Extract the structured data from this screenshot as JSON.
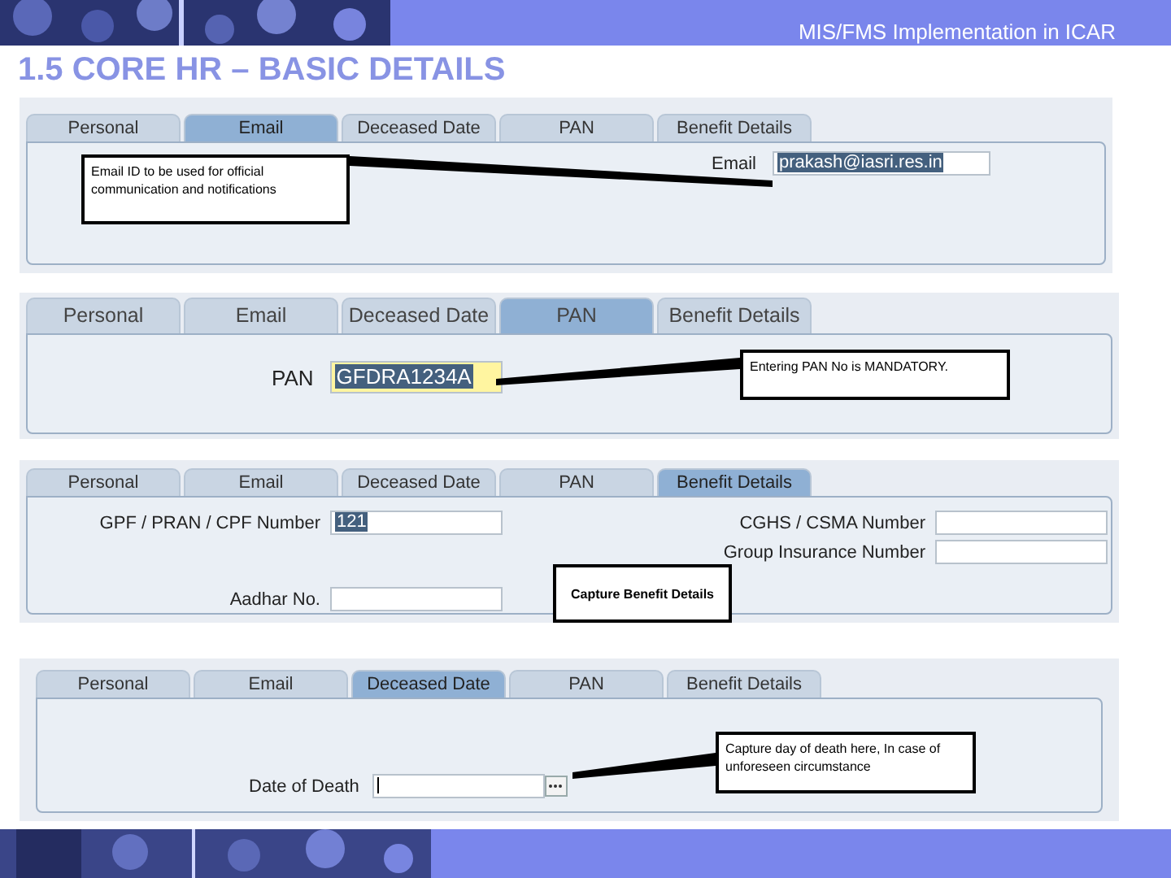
{
  "header": {
    "text": "MIS/FMS Implementation in ICAR"
  },
  "title": "1.5 CORE HR – BASIC DETAILS",
  "panels": [
    {
      "kind": "email",
      "tabs": [
        {
          "label": "Personal",
          "selected": false
        },
        {
          "label": "Email",
          "selected": true
        },
        {
          "label": "Deceased Date",
          "selected": false
        },
        {
          "label": "PAN",
          "selected": false
        },
        {
          "label": "Benefit Details",
          "selected": false
        }
      ],
      "fields": [
        {
          "label": "Email",
          "value": "prakash@iasri.res.in",
          "highlighted": true
        }
      ],
      "callout": "Email ID to be used for official communication and notifications"
    },
    {
      "kind": "pan",
      "tabs": [
        {
          "label": "Personal",
          "selected": false
        },
        {
          "label": "Email",
          "selected": false
        },
        {
          "label": "Deceased Date",
          "selected": false
        },
        {
          "label": "PAN",
          "selected": true
        },
        {
          "label": "Benefit Details",
          "selected": false
        }
      ],
      "fields": [
        {
          "label": "PAN",
          "value": "GFDRA1234A",
          "highlighted": true
        }
      ],
      "callout": "Entering PAN No is  MANDATORY."
    },
    {
      "kind": "benefit",
      "tabs": [
        {
          "label": "Personal",
          "selected": false
        },
        {
          "label": "Email",
          "selected": false
        },
        {
          "label": "Deceased Date",
          "selected": false
        },
        {
          "label": "PAN",
          "selected": false
        },
        {
          "label": "Benefit Details",
          "selected": true
        }
      ],
      "fields": [
        {
          "label": "GPF / PRAN / CPF Number",
          "value": "121",
          "highlighted": true
        },
        {
          "label": "CGHS / CSMA Number"
        },
        {
          "label": "Group Insurance Number"
        },
        {
          "label": "Aadhar No."
        }
      ],
      "callout": "Capture Benefit Details"
    },
    {
      "kind": "death",
      "tabs": [
        {
          "label": "Personal",
          "selected": false
        },
        {
          "label": "Email",
          "selected": false
        },
        {
          "label": "Deceased Date",
          "selected": true
        },
        {
          "label": "PAN",
          "selected": false
        },
        {
          "label": "Benefit Details",
          "selected": false
        }
      ],
      "fields": [
        {
          "label": "Date of Death"
        }
      ],
      "callout": "Capture day of death here, In case of  unforeseen circumstance"
    }
  ]
}
